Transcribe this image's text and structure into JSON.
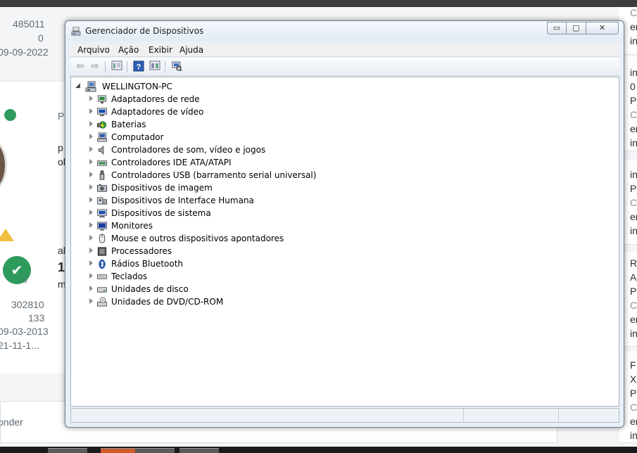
{
  "background": {
    "left_lines": [
      "485011",
      "0",
      "09-09-2022",
      "302810",
      "133",
      "09-03-2013",
      "21-11-1...",
      "onder"
    ],
    "mid_lines": [
      "Po",
      "p",
      "ol",
      "al",
      "1",
      "m"
    ],
    "badge_count": "0",
    "right_lines": [
      "C",
      "er",
      "in",
      "in",
      "0",
      "Po",
      "C",
      "er",
      "in",
      "in",
      "Po",
      "C",
      "er",
      "in",
      "R",
      "A",
      "Po",
      "C",
      "er",
      "in",
      "F",
      "X",
      "Po",
      "C",
      "er",
      "in"
    ]
  },
  "window": {
    "title": "Gerenciador de Dispositivos",
    "controls": {
      "minimize": "▭",
      "maximize": "▢",
      "close": "✕"
    },
    "menu": [
      "Arquivo",
      "Ação",
      "Exibir",
      "Ajuda"
    ],
    "toolbar": [
      "back-icon",
      "forward-icon",
      "properties-icon",
      "help-icon",
      "view-icon",
      "scan-hardware-icon"
    ],
    "tree": {
      "root": "WELLINGTON-PC",
      "items": [
        {
          "label": "Adaptadores de rede",
          "icon": "network-adapter-icon"
        },
        {
          "label": "Adaptadores de vídeo",
          "icon": "display-adapter-icon"
        },
        {
          "label": "Baterias",
          "icon": "battery-icon"
        },
        {
          "label": "Computador",
          "icon": "computer-icon"
        },
        {
          "label": "Controladores de som, vídeo e jogos",
          "icon": "sound-icon"
        },
        {
          "label": "Controladores IDE ATA/ATAPI",
          "icon": "ide-controller-icon"
        },
        {
          "label": "Controladores USB (barramento serial universal)",
          "icon": "usb-icon"
        },
        {
          "label": "Dispositivos de imagem",
          "icon": "camera-icon"
        },
        {
          "label": "Dispositivos de Interface Humana",
          "icon": "hid-icon"
        },
        {
          "label": "Dispositivos de sistema",
          "icon": "system-device-icon"
        },
        {
          "label": "Monitores",
          "icon": "monitor-icon"
        },
        {
          "label": "Mouse e outros dispositivos apontadores",
          "icon": "mouse-icon"
        },
        {
          "label": "Processadores",
          "icon": "processor-icon"
        },
        {
          "label": "Rádios Bluetooth",
          "icon": "bluetooth-icon"
        },
        {
          "label": "Teclados",
          "icon": "keyboard-icon"
        },
        {
          "label": "Unidades de disco",
          "icon": "disk-drive-icon"
        },
        {
          "label": "Unidades de DVD/CD-ROM",
          "icon": "dvd-drive-icon"
        }
      ]
    }
  },
  "colors": {
    "accent_green": "#2e9b5c",
    "window_frame": "#e9eff8"
  }
}
